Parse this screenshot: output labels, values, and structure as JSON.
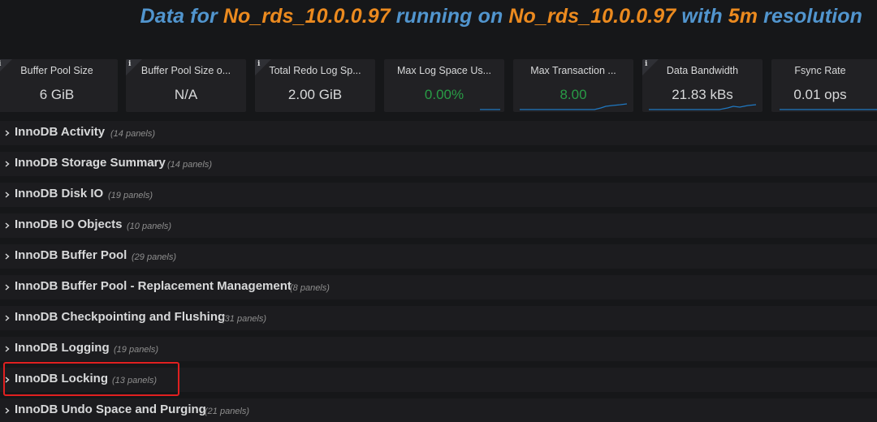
{
  "header": {
    "title_parts": [
      {
        "text": "Data for ",
        "color": "blue"
      },
      {
        "text": "No_rds_10.0.0.97",
        "color": "orange"
      },
      {
        "text": " running on ",
        "color": "blue"
      },
      {
        "text": "No_rds_10.0.0.97",
        "color": "orange"
      },
      {
        "text": " with ",
        "color": "blue"
      },
      {
        "text": "5m",
        "color": "orange"
      },
      {
        "text": " resolution",
        "color": "blue"
      }
    ]
  },
  "colors": {
    "blue": "#5195ce",
    "orange": "#eb8a1f",
    "green": "#299c46",
    "highlight": "#e02020",
    "sparkline": "#1f78c1"
  },
  "stats": [
    {
      "title": "Buffer Pool Size",
      "value": "6 GiB",
      "info_icon": "info-icon"
    },
    {
      "title": "Buffer Pool Size o...",
      "value": "N/A",
      "info_icon": "info-icon"
    },
    {
      "title": "Total Redo Log Sp...",
      "value": "2.00 GiB",
      "info_icon": "info-icon"
    },
    {
      "title": "Max Log Space Us...",
      "value": "0.00%",
      "value_color": "green",
      "sparkline": "flat"
    },
    {
      "title": "Max Transaction ...",
      "value": "8.00",
      "value_color": "green",
      "sparkline": "rising"
    },
    {
      "title": "Data Bandwidth",
      "value": "21.83 kBs",
      "info_icon": "info-icon",
      "sparkline": "rising"
    },
    {
      "title": "Fsync Rate",
      "value": "0.01 ops",
      "sparkline": "flat"
    }
  ],
  "rows": [
    {
      "title": "InnoDB Activity",
      "count": "(14 panels)"
    },
    {
      "title": "InnoDB Storage Summary",
      "count": "(14 panels)"
    },
    {
      "title": "InnoDB Disk IO",
      "count": "(19 panels)"
    },
    {
      "title": "InnoDB IO Objects",
      "count": "(10 panels)"
    },
    {
      "title": "InnoDB Buffer Pool",
      "count": "(29 panels)"
    },
    {
      "title": "InnoDB Buffer Pool - Replacement Management",
      "count": "(8 panels)"
    },
    {
      "title": "InnoDB Checkpointing and Flushing",
      "count": "(31 panels)"
    },
    {
      "title": "InnoDB Logging",
      "count": "(19 panels)"
    },
    {
      "title": "InnoDB Locking",
      "count": "(13 panels)",
      "highlighted": true
    },
    {
      "title": "InnoDB Undo Space and Purging",
      "count": "(21 panels)"
    }
  ]
}
